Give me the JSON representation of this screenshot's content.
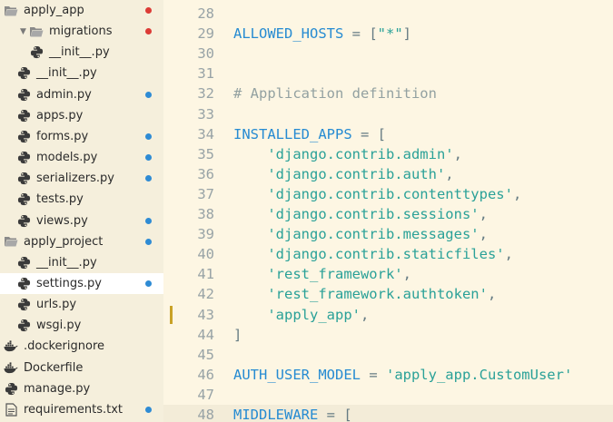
{
  "sidebar": {
    "items": [
      {
        "label": "apply_app",
        "icon": "folder-open-icon",
        "arrow": "",
        "indent": 0,
        "dot": "red"
      },
      {
        "label": "migrations",
        "icon": "folder-open-icon",
        "arrow": "▼",
        "indent": 1,
        "dot": "red"
      },
      {
        "label": "__init__.py",
        "icon": "python-file-icon",
        "arrow": "",
        "indent": 2,
        "dot": ""
      },
      {
        "label": "__init__.py",
        "icon": "python-file-icon",
        "arrow": "",
        "indent": 1,
        "dot": ""
      },
      {
        "label": "admin.py",
        "icon": "python-file-icon",
        "arrow": "",
        "indent": 1,
        "dot": "blue"
      },
      {
        "label": "apps.py",
        "icon": "python-file-icon",
        "arrow": "",
        "indent": 1,
        "dot": ""
      },
      {
        "label": "forms.py",
        "icon": "python-file-icon",
        "arrow": "",
        "indent": 1,
        "dot": "blue"
      },
      {
        "label": "models.py",
        "icon": "python-file-icon",
        "arrow": "",
        "indent": 1,
        "dot": "blue"
      },
      {
        "label": "serializers.py",
        "icon": "python-file-icon",
        "arrow": "",
        "indent": 1,
        "dot": "blue"
      },
      {
        "label": "tests.py",
        "icon": "python-file-icon",
        "arrow": "",
        "indent": 1,
        "dot": ""
      },
      {
        "label": "views.py",
        "icon": "python-file-icon",
        "arrow": "",
        "indent": 1,
        "dot": "blue"
      },
      {
        "label": "apply_project",
        "icon": "folder-open-icon",
        "arrow": "",
        "indent": 0,
        "dot": "blue"
      },
      {
        "label": "__init__.py",
        "icon": "python-file-icon",
        "arrow": "",
        "indent": 1,
        "dot": ""
      },
      {
        "label": "settings.py",
        "icon": "python-file-icon",
        "arrow": "",
        "indent": 1,
        "dot": "blue",
        "selected": true
      },
      {
        "label": "urls.py",
        "icon": "python-file-icon",
        "arrow": "",
        "indent": 1,
        "dot": ""
      },
      {
        "label": "wsgi.py",
        "icon": "python-file-icon",
        "arrow": "",
        "indent": 1,
        "dot": ""
      },
      {
        "label": ".dockerignore",
        "icon": "docker-icon",
        "arrow": "",
        "indent": 0,
        "dot": ""
      },
      {
        "label": "Dockerfile",
        "icon": "docker-icon",
        "arrow": "",
        "indent": 0,
        "dot": ""
      },
      {
        "label": "manage.py",
        "icon": "python-file-icon",
        "arrow": "",
        "indent": 0,
        "dot": ""
      },
      {
        "label": "requirements.txt",
        "icon": "text-file-icon",
        "arrow": "",
        "indent": 0,
        "dot": "blue"
      }
    ]
  },
  "editor": {
    "lines": [
      {
        "n": "28",
        "tokens": []
      },
      {
        "n": "29",
        "tokens": [
          [
            "var",
            "ALLOWED_HOSTS"
          ],
          [
            "op",
            " = ["
          ],
          [
            "str",
            "\"*\""
          ],
          [
            "op",
            "]"
          ]
        ]
      },
      {
        "n": "30",
        "tokens": []
      },
      {
        "n": "31",
        "tokens": []
      },
      {
        "n": "32",
        "tokens": [
          [
            "com",
            "# Application definition"
          ]
        ]
      },
      {
        "n": "33",
        "tokens": []
      },
      {
        "n": "34",
        "tokens": [
          [
            "var",
            "INSTALLED_APPS"
          ],
          [
            "op",
            " = ["
          ]
        ]
      },
      {
        "n": "35",
        "tokens": [
          [
            "op",
            "    "
          ],
          [
            "str",
            "'django.contrib.admin'"
          ],
          [
            "op",
            ","
          ]
        ]
      },
      {
        "n": "36",
        "tokens": [
          [
            "op",
            "    "
          ],
          [
            "str",
            "'django.contrib.auth'"
          ],
          [
            "op",
            ","
          ]
        ]
      },
      {
        "n": "37",
        "tokens": [
          [
            "op",
            "    "
          ],
          [
            "str",
            "'django.contrib.contenttypes'"
          ],
          [
            "op",
            ","
          ]
        ]
      },
      {
        "n": "38",
        "tokens": [
          [
            "op",
            "    "
          ],
          [
            "str",
            "'django.contrib.sessions'"
          ],
          [
            "op",
            ","
          ]
        ]
      },
      {
        "n": "39",
        "tokens": [
          [
            "op",
            "    "
          ],
          [
            "str",
            "'django.contrib.messages'"
          ],
          [
            "op",
            ","
          ]
        ]
      },
      {
        "n": "40",
        "tokens": [
          [
            "op",
            "    "
          ],
          [
            "str",
            "'django.contrib.staticfiles'"
          ],
          [
            "op",
            ","
          ]
        ]
      },
      {
        "n": "41",
        "tokens": [
          [
            "op",
            "    "
          ],
          [
            "str",
            "'rest_framework'"
          ],
          [
            "op",
            ","
          ]
        ]
      },
      {
        "n": "42",
        "tokens": [
          [
            "op",
            "    "
          ],
          [
            "str",
            "'rest_framework.authtoken'"
          ],
          [
            "op",
            ","
          ]
        ]
      },
      {
        "n": "43",
        "tokens": [
          [
            "op",
            "    "
          ],
          [
            "str",
            "'apply_app'"
          ],
          [
            "op",
            ","
          ]
        ],
        "modified": true
      },
      {
        "n": "44",
        "tokens": [
          [
            "op",
            "]"
          ]
        ]
      },
      {
        "n": "45",
        "tokens": []
      },
      {
        "n": "46",
        "tokens": [
          [
            "var",
            "AUTH_USER_MODEL"
          ],
          [
            "op",
            " = "
          ],
          [
            "str",
            "'apply_app.CustomUser'"
          ]
        ]
      },
      {
        "n": "47",
        "tokens": []
      },
      {
        "n": "48",
        "tokens": [
          [
            "var",
            "MIDDLEWARE"
          ],
          [
            "op",
            " = ["
          ]
        ],
        "current": true
      }
    ]
  },
  "colors": {
    "background": "#fdf6e3",
    "sidebar_background": "#f5efdc",
    "identifier": "#268bd2",
    "string": "#2aa198",
    "comment": "#93a1a1",
    "line_number": "#98a3a6",
    "dot_red": "#dc3b36",
    "dot_blue": "#2e8bd4",
    "modified_marker": "#c9a227"
  }
}
